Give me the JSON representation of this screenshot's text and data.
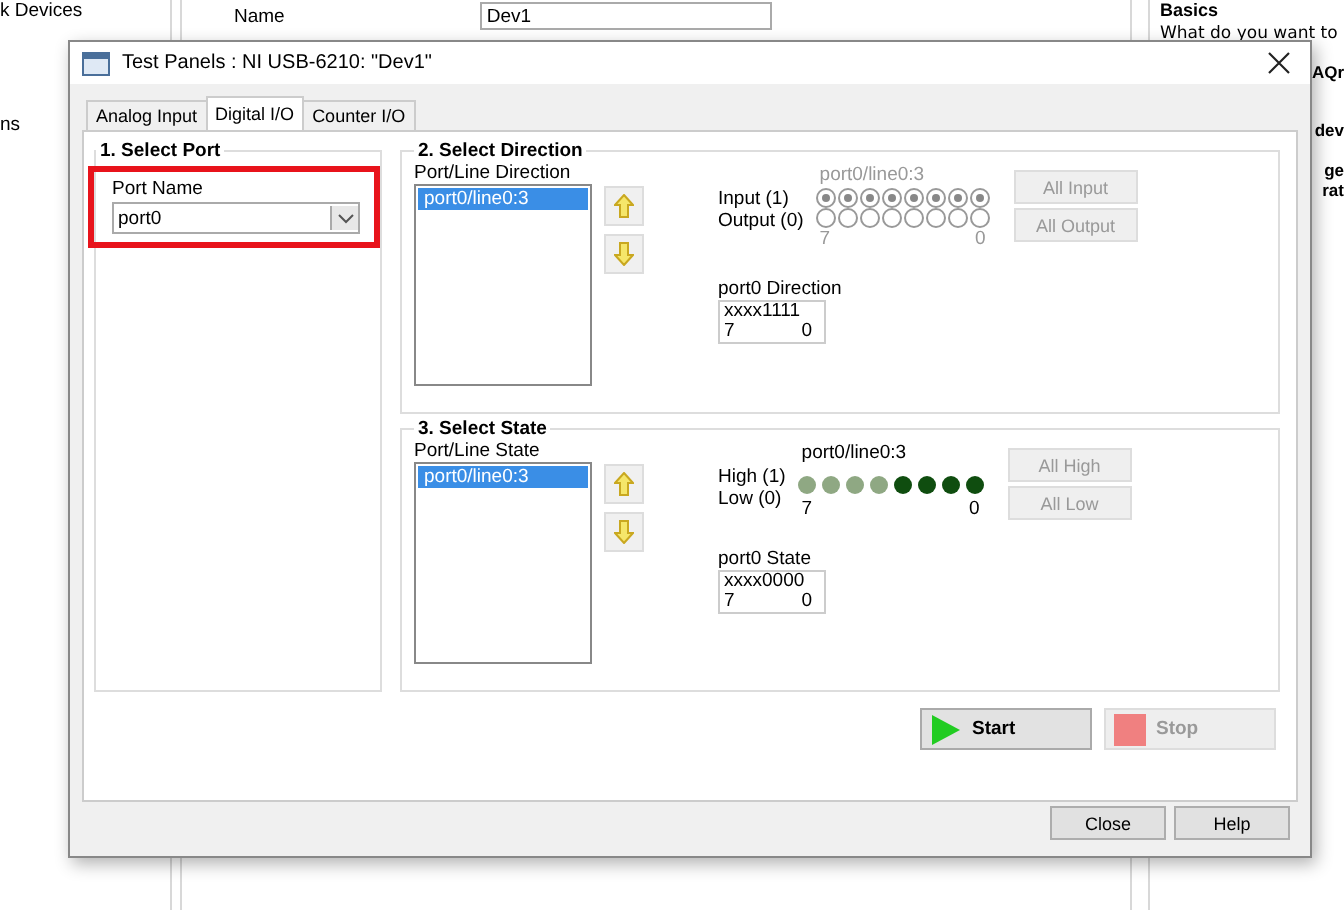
{
  "background": {
    "sidebar_texts": [
      "k Devices",
      "ns"
    ],
    "name_label": "Name",
    "name_value": "Dev1",
    "right_heading": "Basics",
    "right_text": "What do you want to",
    "right_fragments": [
      "AQr",
      "dev",
      "ge",
      "rat"
    ]
  },
  "dialog": {
    "title": "Test Panels : NI USB-6210: \"Dev1\"",
    "tabs": [
      {
        "label": "Analog Input",
        "selected": false
      },
      {
        "label": "Digital I/O",
        "selected": true
      },
      {
        "label": "Counter I/O",
        "selected": false
      }
    ],
    "select_port": {
      "title": "1. Select Port",
      "label": "Port Name",
      "value": "port0",
      "highlighted": true
    },
    "direction": {
      "title": "2. Select Direction",
      "list_label": "Port/Line Direction",
      "items": [
        {
          "label": "port0/line0:3",
          "selected": true
        }
      ],
      "line_label": "port0/line0:3",
      "high_label": "Input (1)",
      "low_label": "Output (0)",
      "bits": [
        {
          "input": true
        },
        {
          "input": true
        },
        {
          "input": true
        },
        {
          "input": true
        },
        {
          "input": true
        },
        {
          "input": true
        },
        {
          "input": true
        },
        {
          "input": true
        }
      ],
      "msb": "7",
      "lsb": "0",
      "buttons": [
        {
          "label": "All Input",
          "disabled": true
        },
        {
          "label": "All Output",
          "disabled": true
        }
      ],
      "readout_label": "port0 Direction",
      "readout_value": "xxxx1111",
      "readout_msb": "7",
      "readout_lsb": "0"
    },
    "state": {
      "title": "3. Select State",
      "list_label": "Port/Line State",
      "items": [
        {
          "label": "port0/line0:3",
          "selected": true
        }
      ],
      "line_label": "port0/line0:3",
      "high_label": "High (1)",
      "low_label": "Low (0)",
      "leds": [
        {
          "disabled": true
        },
        {
          "disabled": true
        },
        {
          "disabled": true
        },
        {
          "disabled": true
        },
        {
          "disabled": false
        },
        {
          "disabled": false
        },
        {
          "disabled": false
        },
        {
          "disabled": false
        }
      ],
      "msb": "7",
      "lsb": "0",
      "buttons": [
        {
          "label": "All High",
          "disabled": true
        },
        {
          "label": "All Low",
          "disabled": true
        }
      ],
      "readout_label": "port0 State",
      "readout_value": "xxxx0000",
      "readout_msb": "7",
      "readout_lsb": "0"
    },
    "start": {
      "label": "Start",
      "disabled": false
    },
    "stop": {
      "label": "Stop",
      "disabled": true
    },
    "footer_buttons": [
      "Close",
      "Help"
    ]
  }
}
